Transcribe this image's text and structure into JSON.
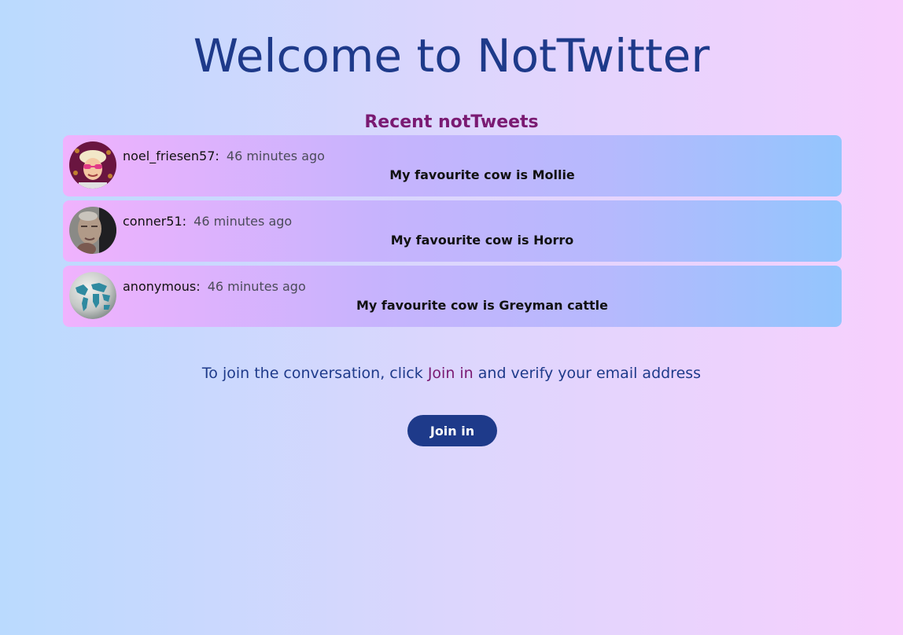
{
  "header": {
    "title": "Welcome to NotTwitter"
  },
  "feed": {
    "title": "Recent notTweets",
    "tweets": [
      {
        "username": "noel_friesen57:",
        "time": "46 minutes ago",
        "text": "My favourite cow is Mollie",
        "avatar_icon": "person-photo-avatar"
      },
      {
        "username": "conner51:",
        "time": "46 minutes ago",
        "text": "My favourite cow is Horro",
        "avatar_icon": "person-photo-avatar"
      },
      {
        "username": "anonymous:",
        "time": "46 minutes ago",
        "text": "My favourite cow is Greyman cattle",
        "avatar_icon": "globe-icon"
      }
    ]
  },
  "join": {
    "prompt_before": "To join the conversation, click ",
    "link_label": "Join in",
    "prompt_after": " and verify your email address",
    "button_label": "Join in"
  },
  "colors": {
    "heading": "#1e3a8a",
    "accent": "#7a1a72",
    "button": "#1e3a8a"
  }
}
